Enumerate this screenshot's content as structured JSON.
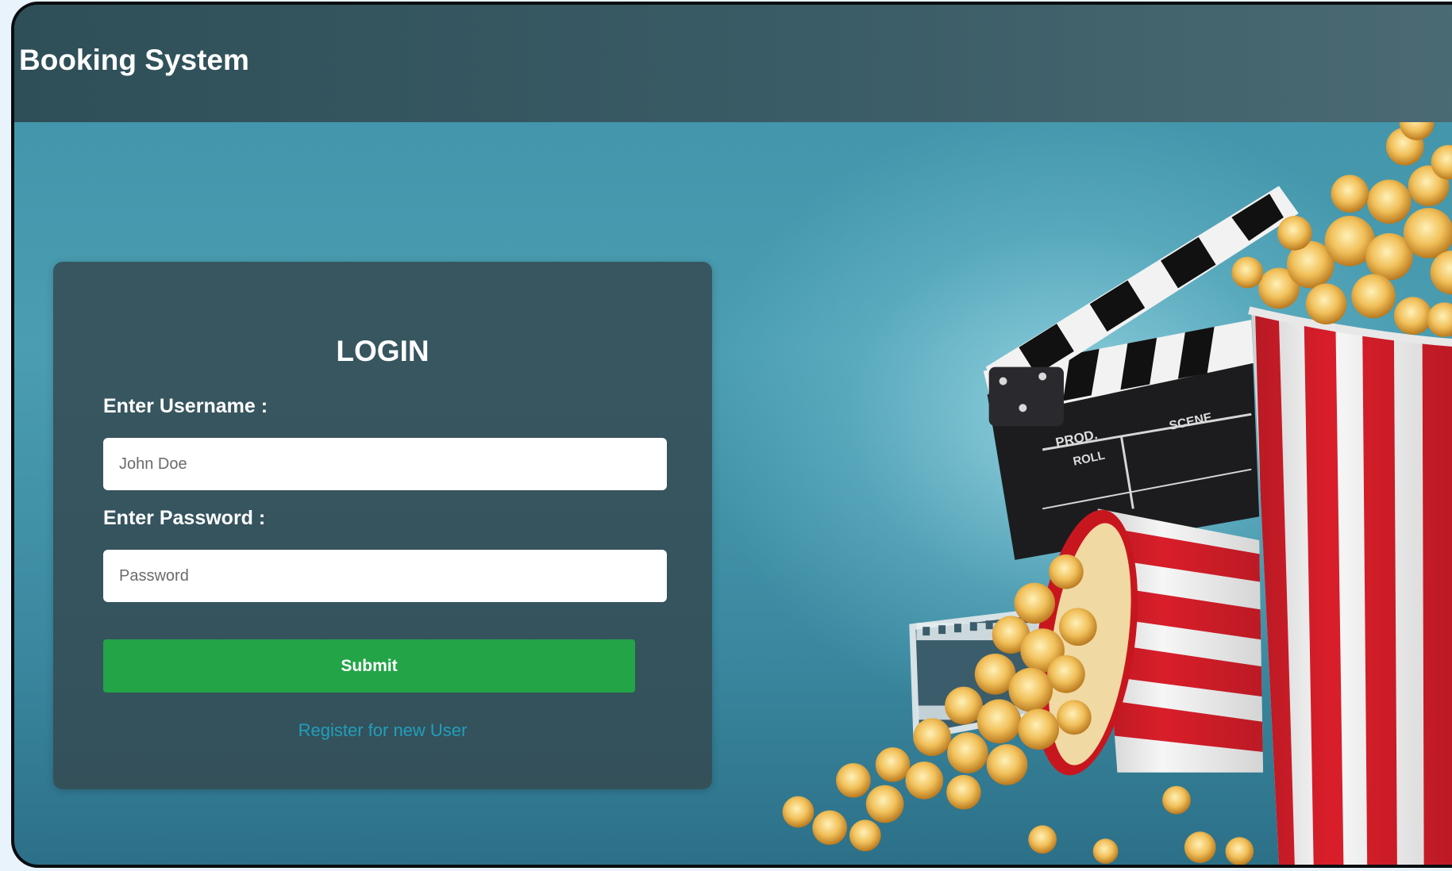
{
  "header": {
    "title": "Booking System"
  },
  "login": {
    "heading": "LOGIN",
    "username_label": "Enter Username :",
    "username_placeholder": "John Doe",
    "password_label": "Enter Password :",
    "password_placeholder": "Password",
    "submit_label": "Submit",
    "register_link": "Register for new User"
  },
  "illustration": {
    "clapperboard_text_prod": "PROD.",
    "clapperboard_text_roll": "ROLL",
    "clapperboard_text_scene": "SCENE"
  },
  "colors": {
    "header_bg": "#35555e",
    "card_bg": "#344a52",
    "submit_bg": "#22a447",
    "link": "#1f9fbd",
    "stripe_red": "#d91e2a"
  },
  "icons": [
    "clapperboard-icon",
    "popcorn-bucket-icon",
    "film-reel-icon"
  ]
}
